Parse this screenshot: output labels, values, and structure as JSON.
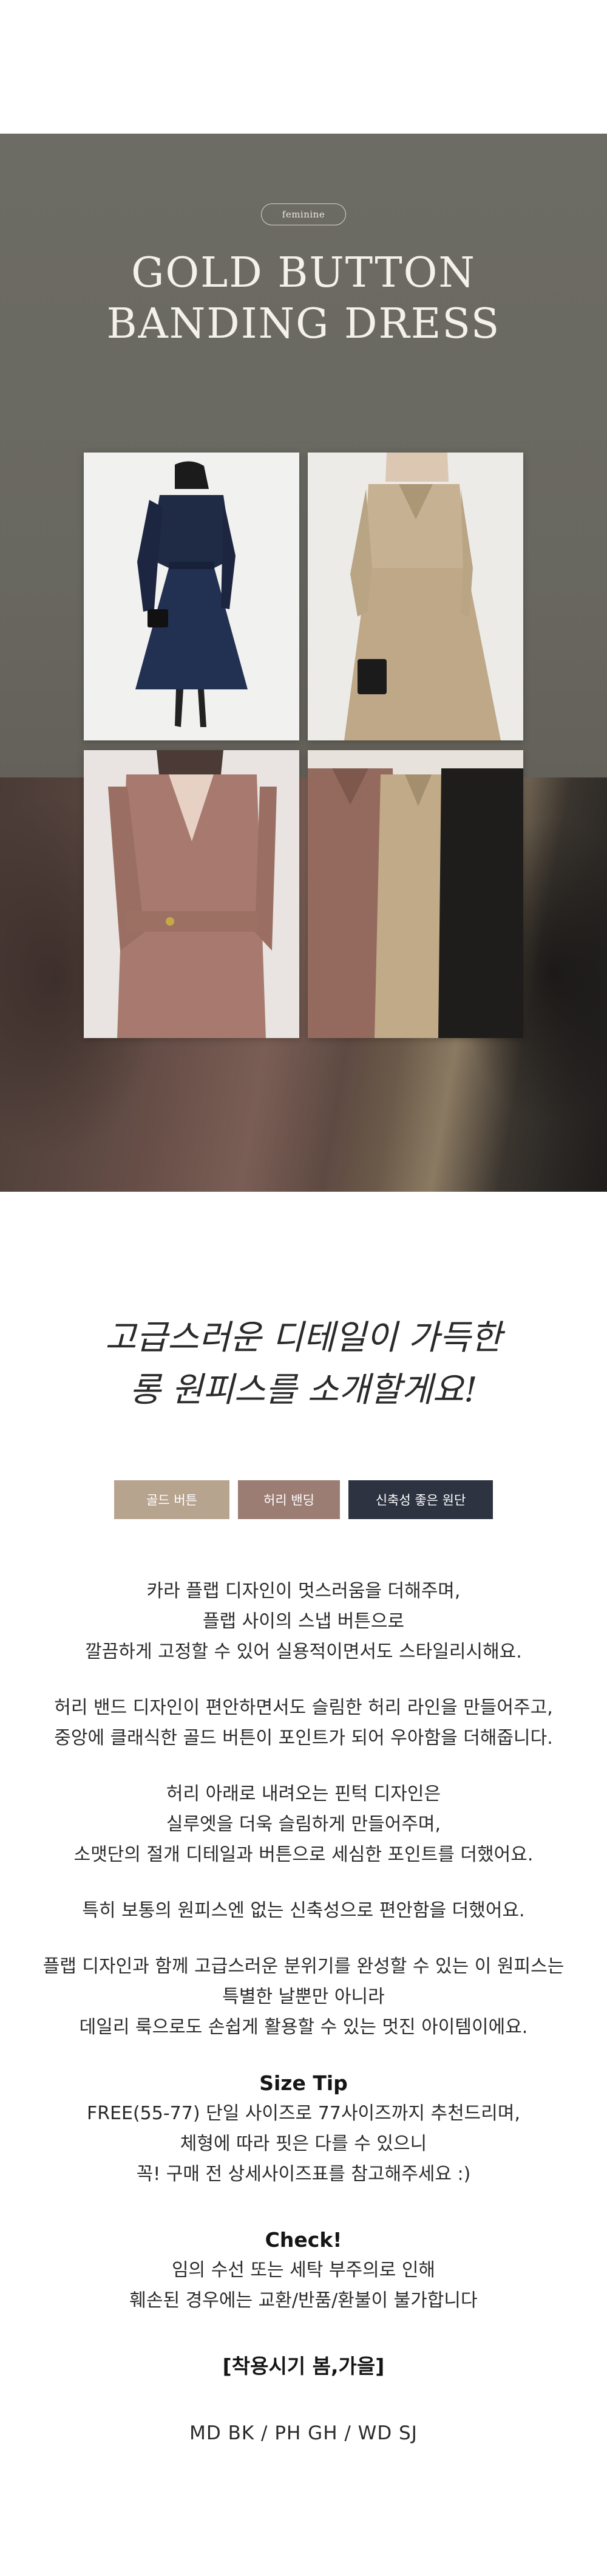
{
  "hero": {
    "badge": "feminine",
    "title_line1": "GOLD BUTTON",
    "title_line2": "BANDING DRESS",
    "desc_line1": "",
    "desc_line2": ""
  },
  "photos": [
    {
      "name": "navy-dress-photo",
      "dress_color": "#1f2a44"
    },
    {
      "name": "beige-dress-photo",
      "dress_color": "#c2ad8c"
    },
    {
      "name": "pink-dress-closeup-photo",
      "dress_color": "#a87a6f"
    },
    {
      "name": "dresses-on-hangers-photo",
      "dress_color": "#8a6257"
    }
  ],
  "headline": {
    "line1": "고급스러운 디테일이 가득한",
    "line2": "롱 원피스를 소개할게요!"
  },
  "tags": [
    {
      "label": "골드 버튼",
      "color": "#b7a48f"
    },
    {
      "label": "허리 밴딩",
      "color": "#9c7d74"
    },
    {
      "label": "신축성 좋은 원단",
      "color": "#2d3341"
    }
  ],
  "description": {
    "p1": [
      "카라 플랩 디자인이 멋스러움을 더해주며,",
      "플랩 사이의 스냅 버튼으로",
      "깔끔하게 고정할 수 있어 실용적이면서도 스타일리시해요."
    ],
    "p2": [
      "허리 밴드 디자인이 편안하면서도 슬림한 허리 라인을 만들어주고,",
      "중앙에 클래식한 골드 버튼이 포인트가 되어 우아함을 더해줍니다."
    ],
    "p3": [
      "허리 아래로 내려오는 핀턱 디자인은",
      "실루엣을 더욱 슬림하게 만들어주며,",
      "소맷단의 절개 디테일과 버튼으로 세심한 포인트를 더했어요."
    ],
    "p4": [
      "특히 보통의 원피스엔 없는 신축성으로 편안함을 더했어요."
    ],
    "p5": [
      "플랩 디자인과 함께 고급스러운 분위기를 완성할 수 있는 이 원피스는",
      "특별한 날뿐만 아니라",
      "데일리 룩으로도 손쉽게 활용할 수 있는 멋진 아이템이에요."
    ]
  },
  "size_tip": {
    "heading": "Size Tip",
    "lines": [
      "FREE(55-77) 단일 사이즈로 77사이즈까지 추천드리며,",
      "체형에 따라 핏은 다를 수 있으니",
      "꼭! 구매 전 상세사이즈표를 참고해주세요 :)"
    ]
  },
  "check": {
    "heading": "Check!",
    "lines": [
      "임의 수선 또는 세탁 부주의로 인해",
      "훼손된 경우에는 교환/반품/환불이 불가합니다"
    ]
  },
  "season": "[착용시기 봄,가을]",
  "colors": "MD BK / PH GH / WD SJ"
}
